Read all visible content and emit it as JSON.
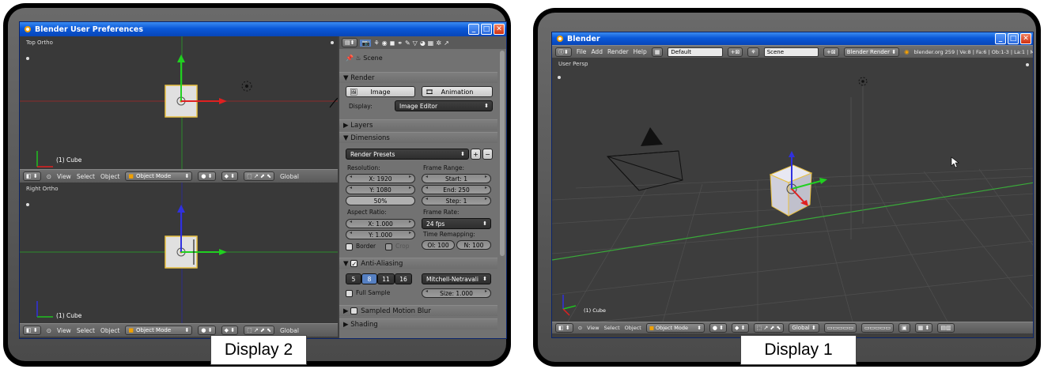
{
  "display2": {
    "caption": "Display 2",
    "window_title": "Blender User Preferences",
    "top_view": {
      "label": "Top Ortho",
      "object": "(1) Cube"
    },
    "bottom_view": {
      "label": "Right Ortho",
      "object": "(1) Cube"
    },
    "header": {
      "view": "View",
      "select": "Select",
      "object": "Object",
      "mode": "Object Mode",
      "orientation": "Global"
    },
    "props": {
      "scene": "Scene",
      "render_panel": "Render",
      "image_btn": "Image",
      "animation_btn": "Animation",
      "display_label": "Display:",
      "display_value": "Image Editor",
      "layers_panel": "Layers",
      "dimensions_panel": "Dimensions",
      "render_presets": "Render Presets",
      "resolution_label": "Resolution:",
      "res_x": "X: 1920",
      "res_y": "Y: 1080",
      "res_pct": "50%",
      "frame_range_label": "Frame Range:",
      "start": "Start: 1",
      "end": "End: 250",
      "step": "Step: 1",
      "aspect_label": "Aspect Ratio:",
      "asp_x": "X: 1.000",
      "asp_y": "Y: 1.000",
      "frame_rate_label": "Frame Rate:",
      "fps": "24 fps",
      "time_remap_label": "Time Remapping:",
      "ol": "Ol: 100",
      "n": "N: 100",
      "border": "Border",
      "crop": "Crop",
      "aa_panel": "Anti-Aliasing",
      "aa_samples": [
        "5",
        "8",
        "11",
        "16"
      ],
      "aa_filter": "Mitchell-Netravali",
      "full_sample": "Full Sample",
      "size": "Size: 1.000",
      "motion_blur_panel": "Sampled Motion Blur",
      "shading_panel": "Shading"
    }
  },
  "display1": {
    "caption": "Display 1",
    "window_title": "Blender",
    "menu": [
      "File",
      "Add",
      "Render",
      "Help"
    ],
    "layout": "Default",
    "scene": "Scene",
    "engine": "Blender Render",
    "stats": "blender.org 259 | Ve:8 | Fa:6 | Ob:1-3 | La:1 | M",
    "view_label": "User Persp",
    "object": "(1) Cube",
    "header": {
      "view": "View",
      "select": "Select",
      "object": "Object",
      "mode": "Object Mode",
      "orientation": "Global"
    }
  },
  "colors": {
    "title_blue": "#0a58d8",
    "viewport_bg": "#393939",
    "x_axis": "#e02020",
    "y_axis": "#20c020",
    "z_axis": "#3030e0",
    "active_blue": "#5680c2"
  }
}
